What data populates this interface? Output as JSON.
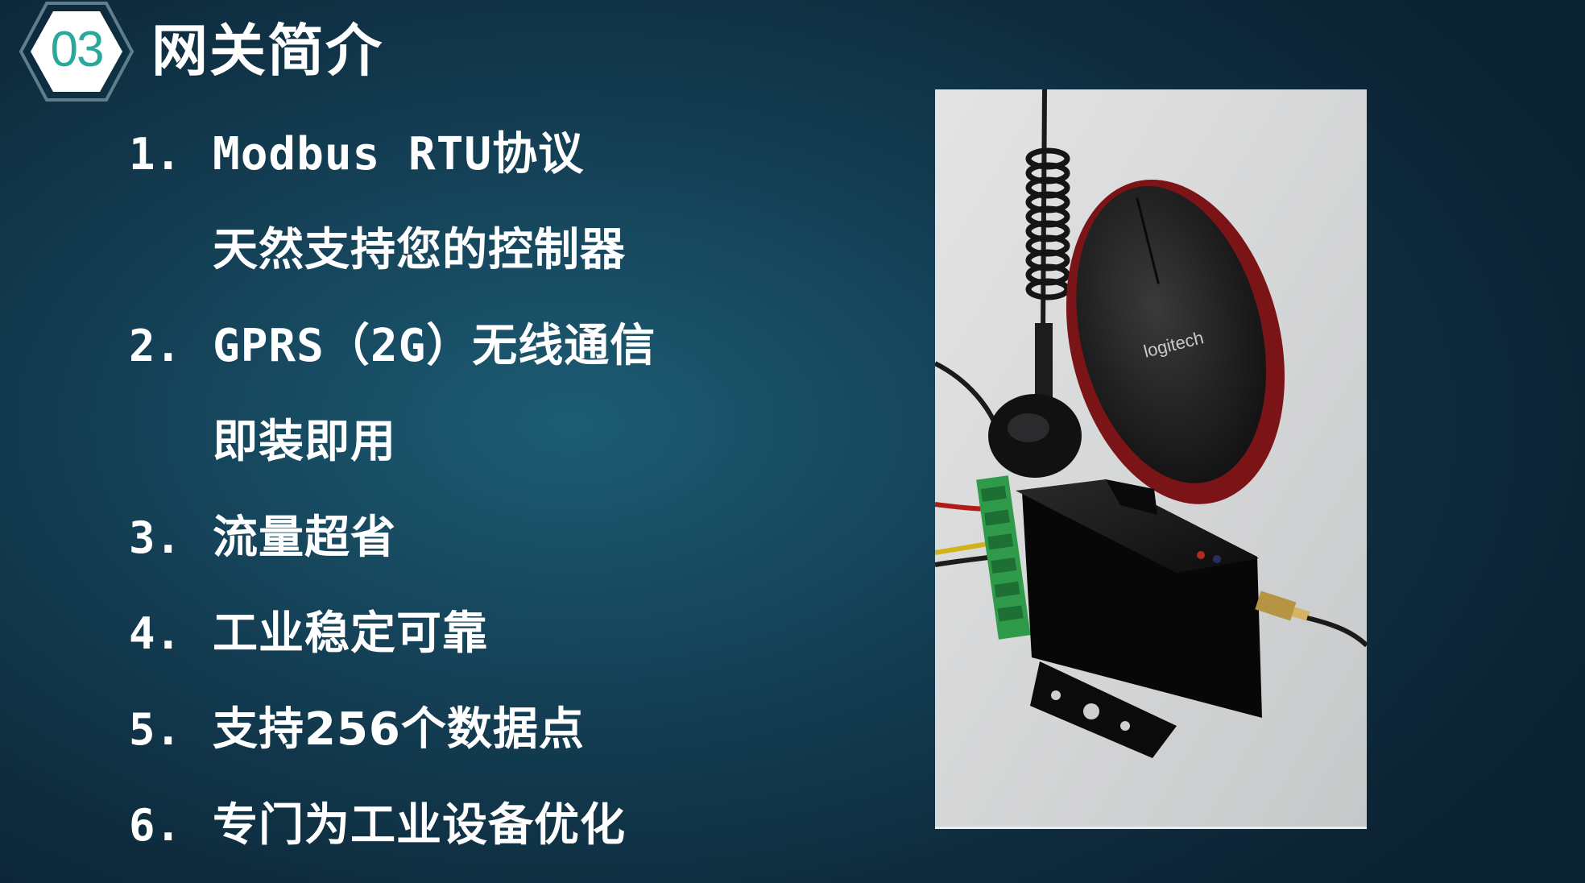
{
  "header": {
    "section_number": "03",
    "title": "网关简介"
  },
  "features": [
    {
      "number": "1.",
      "lines": [
        "Modbus RTU协议",
        "天然支持您的控制器"
      ]
    },
    {
      "number": "2.",
      "lines": [
        "GPRS（2G）无线通信",
        "即装即用"
      ]
    },
    {
      "number": "3.",
      "lines": [
        "流量超省"
      ]
    },
    {
      "number": "4.",
      "lines": [
        "工业稳定可靠"
      ]
    },
    {
      "number": "5.",
      "lines": [
        "支持256个数据点"
      ]
    },
    {
      "number": "6.",
      "lines": [
        "专门为工业设备优化"
      ]
    }
  ],
  "photo": {
    "mouse_brand": "logitech"
  },
  "colors": {
    "accent": "#2aa89a",
    "background": "#143f55",
    "text": "#ffffff"
  }
}
